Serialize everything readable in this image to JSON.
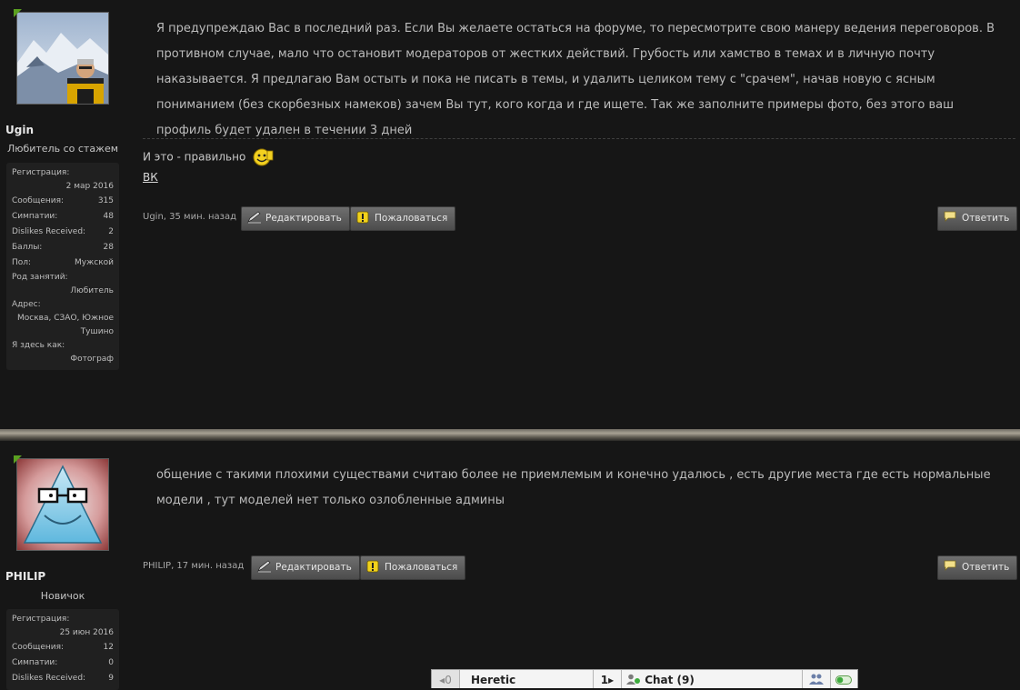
{
  "posts": [
    {
      "username": "Ugin",
      "usertitle": "Любитель со стажем",
      "stats": [
        {
          "label": "Регистрация:",
          "value": "2 мар 2016",
          "block": true
        },
        {
          "label": "Сообщения:",
          "value": "315"
        },
        {
          "label": "Симпатии:",
          "value": "48"
        },
        {
          "label": "Dislikes Received:",
          "value": "2"
        },
        {
          "label": "Баллы:",
          "value": "28"
        },
        {
          "label": "Пол:",
          "value": "Мужской"
        },
        {
          "label": "Род занятий:",
          "value": "Любитель",
          "block": true
        },
        {
          "label": "Адрес:",
          "value": "Москва, СЗАО, Южное Тушино",
          "block": true
        },
        {
          "label": "Я здесь как:",
          "value": "Фотограф",
          "block": true
        }
      ],
      "message": "Я предупреждаю Вас в последний раз. Если Вы желаете остаться на форуме, то пересмотрите свою манеру ведения переговоров. В противном случае, мало что остановит модераторов от жестких действий. Грубость или хамство в темах и в личную почту наказывается. Я предлагаю Вам остыть и пока не писать в темы, и удалить целиком тему с \"срачем\", начав новую с ясным пониманием (без скорбезных намеков) зачем Вы тут, кого когда и где ищете. Так же заполните примеры фото, без этого ваш профиль будет удален в течении 3 дней",
      "signature": "И это - правильно",
      "signature_link": "ВК",
      "author_link": "Ugin",
      "time": ", 35 мин. назад",
      "edit_label": "Редактировать",
      "report_label": "Пожаловаться",
      "reply_label": "Ответить"
    },
    {
      "username": "PHILIP",
      "usertitle": "Новичок",
      "stats": [
        {
          "label": "Регистрация:",
          "value": "25 июн 2016",
          "block": true
        },
        {
          "label": "Сообщения:",
          "value": "12"
        },
        {
          "label": "Симпатии:",
          "value": "0"
        },
        {
          "label": "Dislikes Received:",
          "value": "9"
        }
      ],
      "message": "общение с такими плохими существами считаю более не приемлемым и конечно удалюсь , есть другие места где есть нормальные модели , тут моделей нет только озлобленные админы",
      "author_link": "PHILIP",
      "time": ", 17 мин. назад",
      "edit_label": "Редактировать",
      "report_label": "Пожаловаться",
      "reply_label": "Ответить"
    }
  ],
  "chatbar": {
    "count_left": "0",
    "name": "Heretic",
    "count_mid": "1",
    "chat_label": "Chat (9)"
  }
}
